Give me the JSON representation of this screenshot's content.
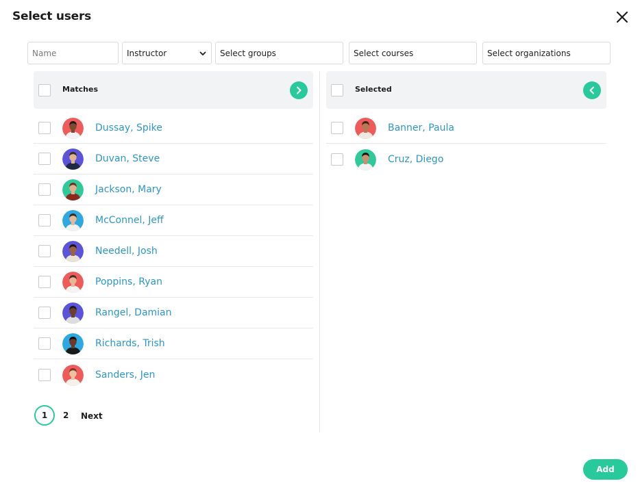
{
  "dialog": {
    "title": "Select users"
  },
  "filters": {
    "name_placeholder": "Name",
    "role_value": "Instructor",
    "groups_placeholder": "Select groups",
    "courses_placeholder": "Select courses",
    "organizations_placeholder": "Select organizations"
  },
  "matches": {
    "header_label": "Matches",
    "users": [
      {
        "name": "Dussay, Spike",
        "avatar_bg": "#ef5b5b",
        "skin": "#7a4a32",
        "hair": "#1a1a1a",
        "shirt": "#f3f3f3"
      },
      {
        "name": "Duvan, Steve",
        "avatar_bg": "#5b53d9",
        "skin": "#e0b491",
        "hair": "#3b2a1f",
        "shirt": "#1e2a44"
      },
      {
        "name": "Jackson, Mary",
        "avatar_bg": "#2fc99a",
        "skin": "#e3b08f",
        "hair": "#6b3220",
        "shirt": "#8a2a1e"
      },
      {
        "name": "McConnel, Jeff",
        "avatar_bg": "#2ea8e0",
        "skin": "#e7b897",
        "hair": "#3a2a20",
        "shirt": "#f2f2f2"
      },
      {
        "name": "Needell, Josh",
        "avatar_bg": "#5b53d9",
        "skin": "#9a6240",
        "hair": "#1f140e",
        "shirt": "#e8e2d6"
      },
      {
        "name": "Poppins, Ryan",
        "avatar_bg": "#ef5b5b",
        "skin": "#e6b696",
        "hair": "#4a2f22",
        "shirt": "#f4f4f4"
      },
      {
        "name": "Rangel, Damian",
        "avatar_bg": "#5b53d9",
        "skin": "#6b3f28",
        "hair": "#1a1a1a",
        "shirt": "#dddddd"
      },
      {
        "name": "Richards, Trish",
        "avatar_bg": "#2ea8e0",
        "skin": "#6a3a26",
        "hair": "#120c09",
        "shirt": "#1a1a1a"
      },
      {
        "name": "Sanders, Jen",
        "avatar_bg": "#ef5b5b",
        "skin": "#ecc2a3",
        "hair": "#7a3a22",
        "shirt": "#f4f0ea"
      }
    ]
  },
  "selected": {
    "header_label": "Selected",
    "users": [
      {
        "name": "Banner, Paula",
        "avatar_bg": "#ef5b5b",
        "skin": "#b47a55",
        "hair": "#3a2418",
        "shirt": "#efe9e0"
      },
      {
        "name": "Cruz, Diego",
        "avatar_bg": "#2fc99a",
        "skin": "#c99072",
        "hair": "#1d1410",
        "shirt": "#f3f3f3"
      }
    ]
  },
  "pagination": {
    "pages": [
      "1",
      "2"
    ],
    "next_label": "Next",
    "current": "1"
  },
  "footer": {
    "add_label": "Add"
  },
  "colors": {
    "accent": "#28c99a",
    "link": "#2d96c6",
    "header_bg": "#f2f3f5"
  },
  "icons": {
    "close": "close-icon",
    "move_right": "chevron-right-icon",
    "move_left": "chevron-left-icon",
    "dropdown": "chevron-down-icon"
  }
}
